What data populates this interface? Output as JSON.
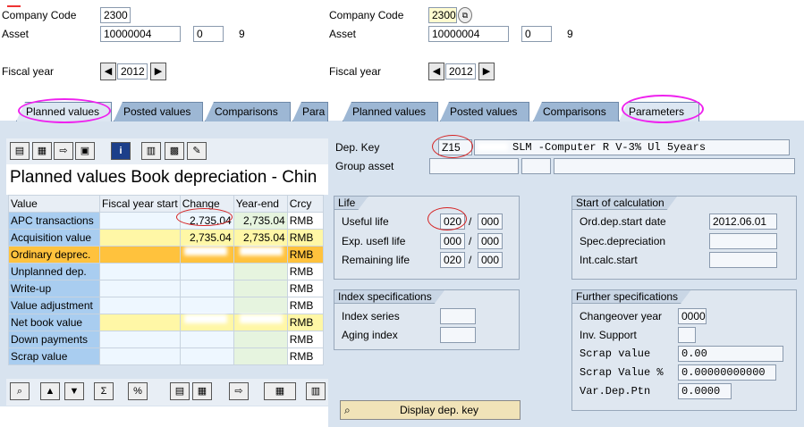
{
  "left": {
    "company_code_label": "Company Code",
    "company_code": "2300",
    "asset_label": "Asset",
    "asset_main": "10000004",
    "asset_sub": "0",
    "asset_extra": "9",
    "fiscal_year_label": "Fiscal year",
    "fiscal_year": "2012",
    "tabs": [
      "Planned values",
      "Posted values",
      "Comparisons",
      "Para"
    ],
    "title": "Planned values Book depreciation - Chin",
    "columns": [
      "Value",
      "Fiscal year start",
      "Change",
      "Year-end",
      "Crcy"
    ],
    "rows": [
      {
        "value": "APC transactions",
        "start": "",
        "change": "2,735.04",
        "end": "2,735.04",
        "crcy": "RMB"
      },
      {
        "value": "Acquisition value",
        "start": "",
        "change": "2,735.04",
        "end": "2,735.04",
        "crcy": "RMB"
      },
      {
        "value": "Ordinary deprec.",
        "start": "",
        "change": "",
        "end": "",
        "crcy": "RMB"
      },
      {
        "value": "Unplanned dep.",
        "start": "",
        "change": "",
        "end": "",
        "crcy": "RMB"
      },
      {
        "value": "Write-up",
        "start": "",
        "change": "",
        "end": "",
        "crcy": "RMB"
      },
      {
        "value": "Value adjustment",
        "start": "",
        "change": "",
        "end": "",
        "crcy": "RMB"
      },
      {
        "value": "Net book value",
        "start": "",
        "change": "",
        "end": "",
        "crcy": "RMB"
      },
      {
        "value": "Down payments",
        "start": "",
        "change": "",
        "end": "",
        "crcy": "RMB"
      },
      {
        "value": "Scrap value",
        "start": "",
        "change": "",
        "end": "",
        "crcy": "RMB"
      }
    ]
  },
  "right": {
    "company_code_label": "Company Code",
    "company_code": "2300",
    "asset_label": "Asset",
    "asset_main": "10000004",
    "asset_sub": "0",
    "asset_extra": "9",
    "fiscal_year_label": "Fiscal year",
    "fiscal_year": "2012",
    "tabs": [
      "Planned values",
      "Posted values",
      "Comparisons",
      "Parameters"
    ],
    "dep_key_label": "Dep. Key",
    "dep_key": "Z15",
    "dep_key_desc": "SLM -Computer R V-3% Ul 5years",
    "group_asset_label": "Group asset",
    "life": {
      "title": "Life",
      "useful_life_label": "Useful life",
      "useful_life_years": "020",
      "useful_life_periods": "000",
      "exp_life_label": "Exp. usefl life",
      "exp_life_years": "000",
      "exp_life_periods": "000",
      "remaining_label": "Remaining life",
      "remaining_years": "020",
      "remaining_periods": "000",
      "slash": "/"
    },
    "calc": {
      "title": "Start of calculation",
      "ord_dep_label": "Ord.dep.start date",
      "ord_dep": "2012.06.01",
      "spec_dep_label": "Spec.depreciation",
      "int_calc_label": "Int.calc.start"
    },
    "index": {
      "title": "Index specifications",
      "series_label": "Index series",
      "aging_label": "Aging index"
    },
    "further": {
      "title": "Further specifications",
      "changeover_label": "Changeover year",
      "changeover": "0000",
      "inv_support_label": "Inv. Support",
      "scrap_value_label": "Scrap value",
      "scrap_value": "0.00",
      "scrap_pct_label": "Scrap Value %",
      "scrap_pct": "0.00000000000",
      "var_dep_label": "Var.Dep.Ptn",
      "var_dep": "0.0000"
    },
    "display_btn": "Display dep. key"
  }
}
